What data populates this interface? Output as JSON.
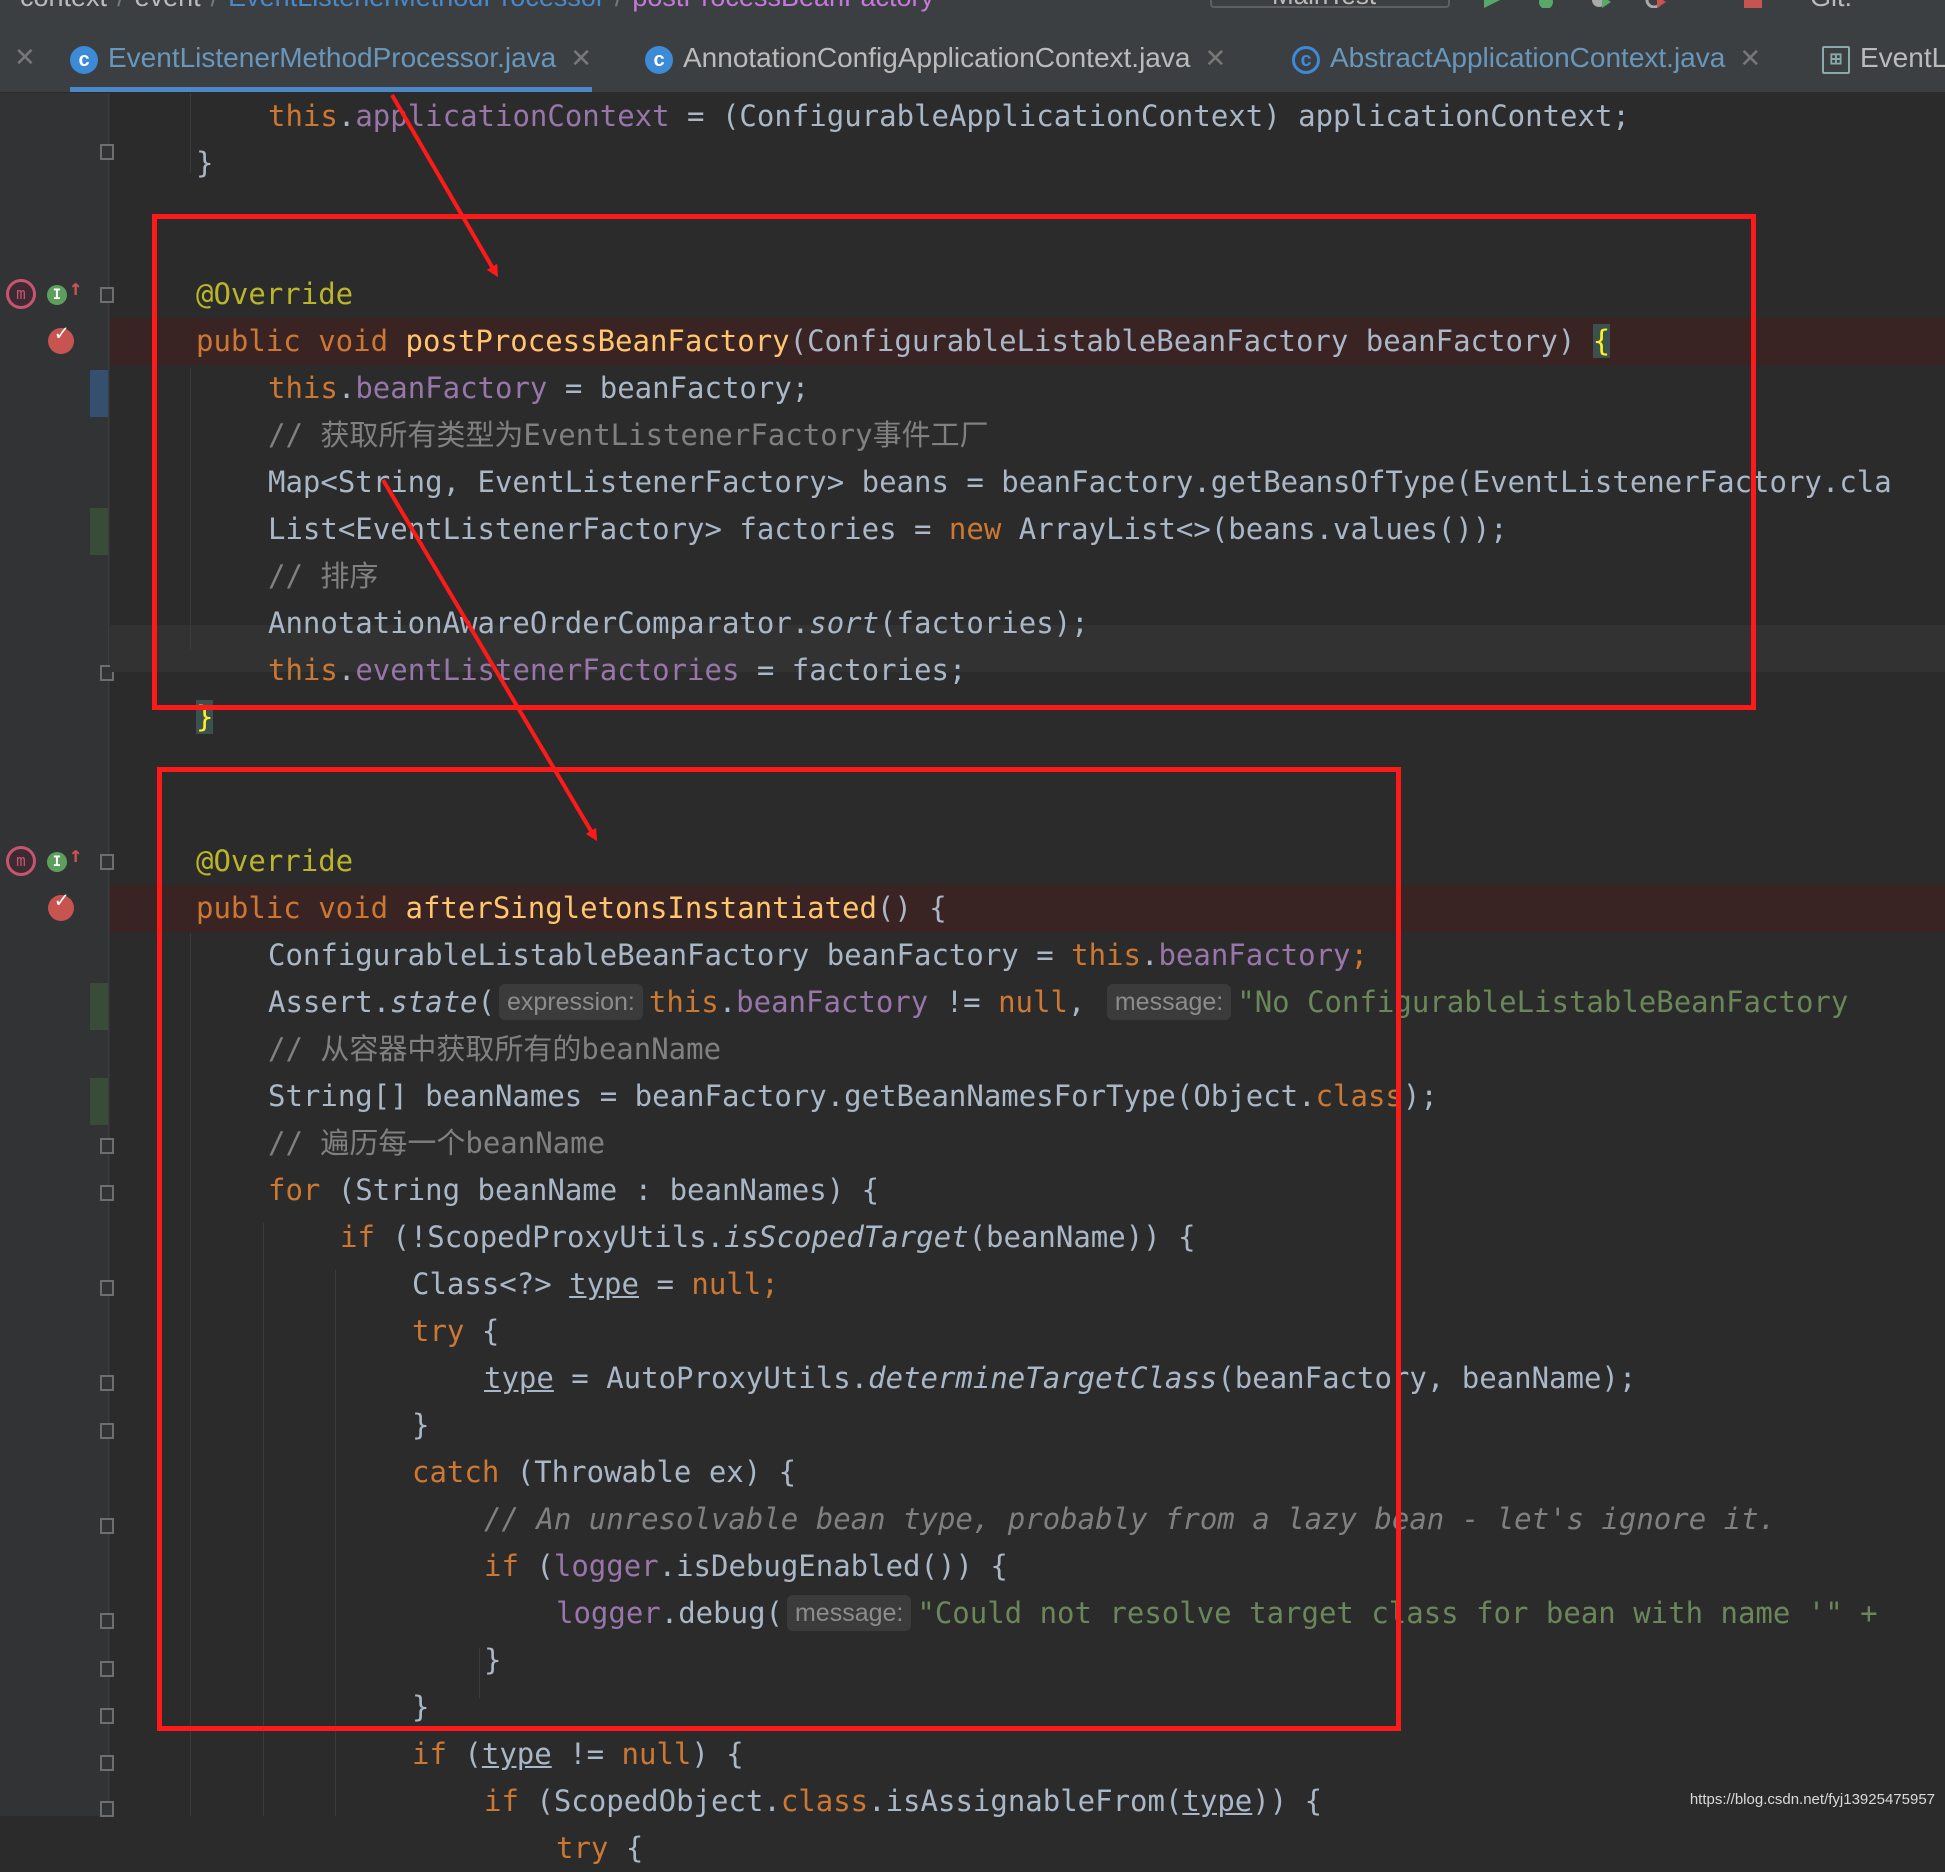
{
  "breadcrumbs": [
    "context",
    "event",
    "EventListenerMethodProcessor",
    "postProcessBeanFactory"
  ],
  "run_config": "MainTest",
  "vcs_label": "Git:",
  "tabs": [
    {
      "label": "EventListenerMethodProcessor.java",
      "icon": "class-icon",
      "active": true
    },
    {
      "label": "AnnotationConfigApplicationContext.java",
      "icon": "class-icon",
      "active": false
    },
    {
      "label": "AbstractApplicationContext.java",
      "icon": "abstract-class-icon",
      "active": false
    },
    {
      "label": "EventL",
      "icon": "structure-icon",
      "active": false
    }
  ],
  "hints": {
    "expression": "expression:",
    "message": "message:"
  },
  "code": {
    "l1a": "this",
    "l1b": ".",
    "l1c": "applicationContext",
    "l1d": " = (ConfigurableApplicationContext) applicationContext;",
    "l2": "}",
    "l3": "@Override",
    "l4a": "public void ",
    "l4b": "postProcessBeanFactory",
    "l4c": "(ConfigurableListableBeanFactory beanFactory) ",
    "l4d": "{",
    "l5a": "this",
    "l5b": ".",
    "l5c": "beanFactory",
    "l5d": " = beanFactory;",
    "l6": "// 获取所有类型为EventListenerFactory事件工厂",
    "l7": "Map<String, EventListenerFactory> beans = beanFactory.getBeansOfType(EventListenerFactory.cla",
    "l8a": "List<EventListenerFactory> factories = ",
    "l8b": "new ",
    "l8c": "ArrayList<>(beans.values());",
    "l9": "// 排序",
    "l10a": "AnnotationAwareOrderComparator.",
    "l10b": "sort",
    "l10c": "(factories);",
    "l11a": "this",
    "l11b": ".",
    "l11c": "eventListenerFactories",
    "l11d": " = factories;",
    "l12": "}",
    "l13": "@Override",
    "l14a": "public void ",
    "l14b": "afterSingletonsInstantiated",
    "l14c": "() {",
    "l15a": "ConfigurableListableBeanFactory beanFactory = ",
    "l15b": "this",
    "l15c": ".",
    "l15d": "beanFactory",
    "l15e": ";",
    "l16a": "Assert.",
    "l16b": "state",
    "l16c": "(",
    "l16d": "this",
    "l16e": ".",
    "l16f": "beanFactory",
    "l16g": " != ",
    "l16h": "null",
    "l16i": ", ",
    "l16j": "\"No ConfigurableListableBeanFactory",
    "l17": "// 从容器中获取所有的beanName",
    "l18a": "String[] beanNames = beanFactory.getBeanNamesForType(Object.",
    "l18b": "class",
    "l18c": ");",
    "l19": "// 遍历每一个beanName",
    "l20a": "for ",
    "l20b": "(String beanName : beanNames) {",
    "l21a": "if ",
    "l21b": "(!ScopedProxyUtils.",
    "l21c": "isScopedTarget",
    "l21d": "(beanName)) {",
    "l22a": "Class<?> ",
    "l22b": "type",
    "l22c": " = ",
    "l22d": "null",
    "l22e": ";",
    "l23a": "try ",
    "l23b": "{",
    "l24a": "type",
    "l24b": " = AutoProxyUtils.",
    "l24c": "determineTargetClass",
    "l24d": "(beanFactory, beanName);",
    "l25": "}",
    "l26a": "catch ",
    "l26b": "(Throwable ex) {",
    "l27": "// An unresolvable bean type, probably from a lazy bean - let's ignore it.",
    "l28a": "if ",
    "l28b": "(",
    "l28c": "logger",
    "l28d": ".isDebugEnabled()) {",
    "l29a": "logger",
    "l29b": ".debug(",
    "l29c": "\"Could not resolve target class for bean with name '\" +",
    "l30": "}",
    "l31": "}",
    "l32a": "if ",
    "l32b": "(",
    "l32c": "type",
    "l32d": " != ",
    "l32e": "null",
    "l32f": ") {",
    "l33a": "if ",
    "l33b": "(ScopedObject.",
    "l33c": "class",
    "l33d": ".isAssignableFrom(",
    "l33e": "type",
    "l33f": ")) {",
    "l34a": "try ",
    "l34b": "{"
  },
  "watermark": "https://blog.csdn.net/fyj13925475957",
  "colors": {
    "editor_bg": "#2b2b2b",
    "keyword": "#cc7832",
    "field": "#9876aa",
    "annotation": "#bbb529",
    "method": "#ffc66d",
    "string": "#6a8759",
    "comment": "#808080",
    "annotation_box": "#ff1a1a"
  }
}
